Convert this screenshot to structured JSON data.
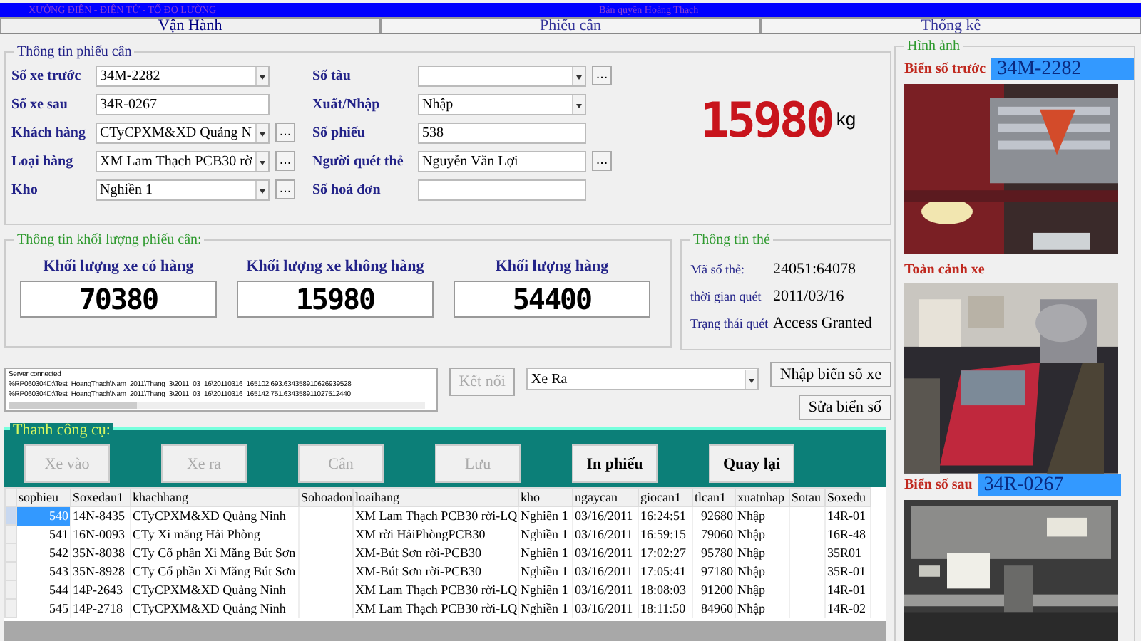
{
  "header": {
    "left_text": "XƯỞNG ĐIỆN - ĐIỆN TỬ - TỔ ĐO LƯỜNG",
    "right_text": "Bản quyền Hoàng Thạch"
  },
  "tabs": [
    {
      "label": "Vận Hành",
      "selected": true
    },
    {
      "label": "Phiếu cân",
      "selected": false
    },
    {
      "label": "Thống kê",
      "selected": false
    }
  ],
  "ticket": {
    "title": "Thông tin phiếu cân",
    "left_fields": [
      {
        "label": "Số xe trước",
        "kind": "combo",
        "value": "34M-2282"
      },
      {
        "label": "Số xe sau",
        "kind": "text",
        "value": "34R-0267"
      },
      {
        "label": "Khách hàng",
        "kind": "combo",
        "value": "CTyCPXM&XD Quảng N",
        "button": "..."
      },
      {
        "label": "Loại hàng",
        "kind": "combo",
        "value": "XM Lam Thạch PCB30 rờ",
        "button": "..."
      },
      {
        "label": "Kho",
        "kind": "combo",
        "value": "Nghiền 1",
        "button": "..."
      }
    ],
    "right_fields": [
      {
        "label": "Số tàu",
        "kind": "combo",
        "button": "..."
      },
      {
        "label": "Xuất/Nhập",
        "kind": "combo",
        "value": "Nhập"
      },
      {
        "label": "Số phiếu",
        "kind": "text",
        "value": "538"
      },
      {
        "label": "Người quét thẻ",
        "kind": "text",
        "value": "Nguyễn Văn Lợi",
        "button": "..."
      },
      {
        "label": "Số hoá đơn",
        "kind": "text"
      }
    ],
    "reading": "15980",
    "unit": "kg"
  },
  "weights": {
    "title": "Thông tin khối lượng phiếu cân:",
    "items": [
      {
        "label": "Khối lượng xe có hàng",
        "value": "70380"
      },
      {
        "label": "Khối lượng xe không hàng",
        "value": "15980"
      },
      {
        "label": "Khối lượng hàng",
        "value": "54400"
      }
    ]
  },
  "card": {
    "title": "Thông tin thẻ",
    "rows": [
      {
        "label": "Mã số thẻ:",
        "value": "24051:64078"
      },
      {
        "label": "thời gian quét",
        "value": "2011/03/16"
      },
      {
        "label": "Trạng thái quét",
        "value": "Access Granted"
      }
    ]
  },
  "log": [
    "Server connected",
    "%RP060304D:\\Test_HoangThach\\Nam_2011\\Thang_3\\2011_03_16\\20110316_165102.693.634358910626939528_",
    "%RP060304D:\\Test_HoangThach\\Nam_2011\\Thang_3\\2011_03_16\\20110316_165142.751.634358911027512440_"
  ],
  "connect_button": {
    "label": "Kết nối",
    "disabled": true
  },
  "direction": {
    "value": "Xe Ra"
  },
  "side_buttons": [
    "Nhập biển số xe",
    "Sửa biển số"
  ],
  "toolbar": {
    "title": "Thanh công cụ:",
    "buttons": [
      {
        "label": "Xe vào",
        "disabled": true
      },
      {
        "label": "Xe ra",
        "disabled": true
      },
      {
        "label": "Cân",
        "disabled": true
      },
      {
        "label": "Lưu",
        "disabled": true
      },
      {
        "label": "In phiếu",
        "disabled": false
      },
      {
        "label": "Quay lại",
        "disabled": false
      }
    ]
  },
  "table": {
    "columns": [
      "sophieu",
      "Soxedau1",
      "khachhang",
      "Sohoadon",
      "loaihang",
      "kho",
      "ngaycan",
      "giocan1",
      "tlcan1",
      "xuatnhap",
      "Sotau",
      "Soxedu"
    ],
    "rows": [
      {
        "selected": true,
        "cells": [
          "540",
          "14N-8435",
          "CTyCPXM&XD Quảng Ninh",
          "",
          "XM Lam Thạch PCB30 rời-LQ",
          "Nghiền 1",
          "03/16/2011",
          "16:24:51",
          "92680",
          "Nhập",
          "",
          "14R-01"
        ]
      },
      {
        "selected": false,
        "cells": [
          "541",
          "16N-0093",
          "CTy Xi măng Hải Phòng",
          "",
          "XM rời HảiPhòngPCB30",
          "Nghiền 1",
          "03/16/2011",
          "16:59:15",
          "79060",
          "Nhập",
          "",
          "16R-48"
        ]
      },
      {
        "selected": false,
        "cells": [
          "542",
          "35N-8038",
          "CTy Cổ phần Xi Măng Bút Sơn",
          "",
          "XM-Bút Sơn rời-PCB30",
          "Nghiền 1",
          "03/16/2011",
          "17:02:27",
          "95780",
          "Nhập",
          "",
          "35R01"
        ]
      },
      {
        "selected": false,
        "cells": [
          "543",
          "35N-8928",
          "CTy Cổ phần Xi Măng Bút Sơn",
          "",
          "XM-Bút Sơn rời-PCB30",
          "Nghiền 1",
          "03/16/2011",
          "17:05:41",
          "97180",
          "Nhập",
          "",
          "35R-01"
        ]
      },
      {
        "selected": false,
        "cells": [
          "544",
          "14P-2643",
          "CTyCPXM&XD Quảng Ninh",
          "",
          "XM Lam Thạch PCB30 rời-LQ",
          "Nghiền 1",
          "03/16/2011",
          "18:08:03",
          "91200",
          "Nhập",
          "",
          "14R-01"
        ]
      },
      {
        "selected": false,
        "cells": [
          "545",
          "14P-2718",
          "CTyCPXM&XD Quảng Ninh",
          "",
          "XM Lam Thạch PCB30 rời-LQ",
          "Nghiền 1",
          "03/16/2011",
          "18:11:50",
          "84960",
          "Nhập",
          "",
          "14R-02"
        ]
      }
    ]
  },
  "images": {
    "title": "Hình ảnh",
    "sections": [
      {
        "kind": "plate",
        "label": "Biển số trước",
        "plate": "34M-2282"
      },
      {
        "kind": "picture"
      },
      {
        "kind": "caption",
        "label": "Toàn cảnh xe"
      },
      {
        "kind": "picture"
      },
      {
        "kind": "plate",
        "label": "Biển số sau",
        "plate": "34R-0267"
      },
      {
        "kind": "picture"
      }
    ]
  }
}
